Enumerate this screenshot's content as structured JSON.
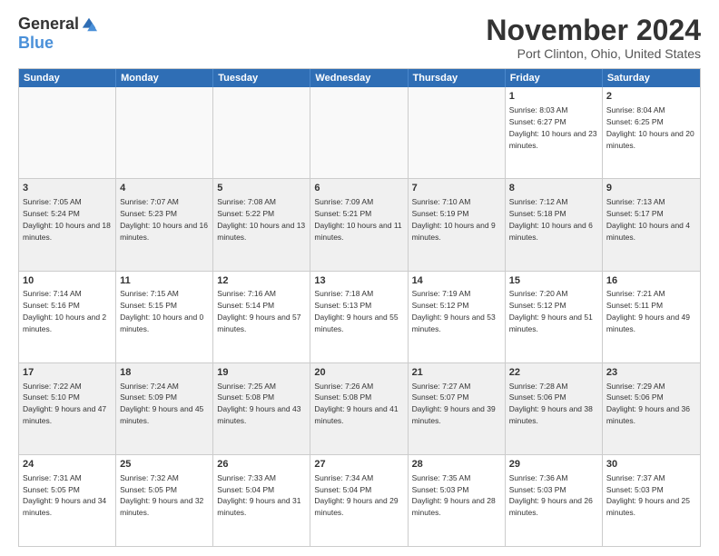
{
  "logo": {
    "general": "General",
    "blue": "Blue"
  },
  "title": "November 2024",
  "location": "Port Clinton, Ohio, United States",
  "days_of_week": [
    "Sunday",
    "Monday",
    "Tuesday",
    "Wednesday",
    "Thursday",
    "Friday",
    "Saturday"
  ],
  "weeks": [
    [
      {
        "day": "",
        "empty": true,
        "text": ""
      },
      {
        "day": "",
        "empty": true,
        "text": ""
      },
      {
        "day": "",
        "empty": true,
        "text": ""
      },
      {
        "day": "",
        "empty": true,
        "text": ""
      },
      {
        "day": "",
        "empty": true,
        "text": ""
      },
      {
        "day": "1",
        "text": "Sunrise: 8:03 AM\nSunset: 6:27 PM\nDaylight: 10 hours and 23 minutes."
      },
      {
        "day": "2",
        "text": "Sunrise: 8:04 AM\nSunset: 6:25 PM\nDaylight: 10 hours and 20 minutes."
      }
    ],
    [
      {
        "day": "3",
        "text": "Sunrise: 7:05 AM\nSunset: 5:24 PM\nDaylight: 10 hours and 18 minutes."
      },
      {
        "day": "4",
        "text": "Sunrise: 7:07 AM\nSunset: 5:23 PM\nDaylight: 10 hours and 16 minutes."
      },
      {
        "day": "5",
        "text": "Sunrise: 7:08 AM\nSunset: 5:22 PM\nDaylight: 10 hours and 13 minutes."
      },
      {
        "day": "6",
        "text": "Sunrise: 7:09 AM\nSunset: 5:21 PM\nDaylight: 10 hours and 11 minutes."
      },
      {
        "day": "7",
        "text": "Sunrise: 7:10 AM\nSunset: 5:19 PM\nDaylight: 10 hours and 9 minutes."
      },
      {
        "day": "8",
        "text": "Sunrise: 7:12 AM\nSunset: 5:18 PM\nDaylight: 10 hours and 6 minutes."
      },
      {
        "day": "9",
        "text": "Sunrise: 7:13 AM\nSunset: 5:17 PM\nDaylight: 10 hours and 4 minutes."
      }
    ],
    [
      {
        "day": "10",
        "text": "Sunrise: 7:14 AM\nSunset: 5:16 PM\nDaylight: 10 hours and 2 minutes."
      },
      {
        "day": "11",
        "text": "Sunrise: 7:15 AM\nSunset: 5:15 PM\nDaylight: 10 hours and 0 minutes."
      },
      {
        "day": "12",
        "text": "Sunrise: 7:16 AM\nSunset: 5:14 PM\nDaylight: 9 hours and 57 minutes."
      },
      {
        "day": "13",
        "text": "Sunrise: 7:18 AM\nSunset: 5:13 PM\nDaylight: 9 hours and 55 minutes."
      },
      {
        "day": "14",
        "text": "Sunrise: 7:19 AM\nSunset: 5:12 PM\nDaylight: 9 hours and 53 minutes."
      },
      {
        "day": "15",
        "text": "Sunrise: 7:20 AM\nSunset: 5:12 PM\nDaylight: 9 hours and 51 minutes."
      },
      {
        "day": "16",
        "text": "Sunrise: 7:21 AM\nSunset: 5:11 PM\nDaylight: 9 hours and 49 minutes."
      }
    ],
    [
      {
        "day": "17",
        "text": "Sunrise: 7:22 AM\nSunset: 5:10 PM\nDaylight: 9 hours and 47 minutes."
      },
      {
        "day": "18",
        "text": "Sunrise: 7:24 AM\nSunset: 5:09 PM\nDaylight: 9 hours and 45 minutes."
      },
      {
        "day": "19",
        "text": "Sunrise: 7:25 AM\nSunset: 5:08 PM\nDaylight: 9 hours and 43 minutes."
      },
      {
        "day": "20",
        "text": "Sunrise: 7:26 AM\nSunset: 5:08 PM\nDaylight: 9 hours and 41 minutes."
      },
      {
        "day": "21",
        "text": "Sunrise: 7:27 AM\nSunset: 5:07 PM\nDaylight: 9 hours and 39 minutes."
      },
      {
        "day": "22",
        "text": "Sunrise: 7:28 AM\nSunset: 5:06 PM\nDaylight: 9 hours and 38 minutes."
      },
      {
        "day": "23",
        "text": "Sunrise: 7:29 AM\nSunset: 5:06 PM\nDaylight: 9 hours and 36 minutes."
      }
    ],
    [
      {
        "day": "24",
        "text": "Sunrise: 7:31 AM\nSunset: 5:05 PM\nDaylight: 9 hours and 34 minutes."
      },
      {
        "day": "25",
        "text": "Sunrise: 7:32 AM\nSunset: 5:05 PM\nDaylight: 9 hours and 32 minutes."
      },
      {
        "day": "26",
        "text": "Sunrise: 7:33 AM\nSunset: 5:04 PM\nDaylight: 9 hours and 31 minutes."
      },
      {
        "day": "27",
        "text": "Sunrise: 7:34 AM\nSunset: 5:04 PM\nDaylight: 9 hours and 29 minutes."
      },
      {
        "day": "28",
        "text": "Sunrise: 7:35 AM\nSunset: 5:03 PM\nDaylight: 9 hours and 28 minutes."
      },
      {
        "day": "29",
        "text": "Sunrise: 7:36 AM\nSunset: 5:03 PM\nDaylight: 9 hours and 26 minutes."
      },
      {
        "day": "30",
        "text": "Sunrise: 7:37 AM\nSunset: 5:03 PM\nDaylight: 9 hours and 25 minutes."
      }
    ]
  ]
}
